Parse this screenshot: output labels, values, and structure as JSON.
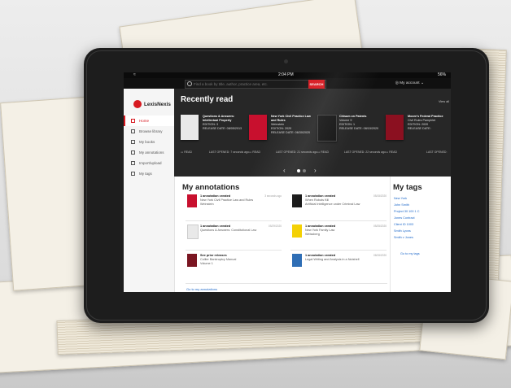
{
  "statusbar": {
    "time": "2:04 PM",
    "battery": "56%"
  },
  "search": {
    "placeholder": "Find a book by title, author, practice area, etc.",
    "button": "SEARCH"
  },
  "account": {
    "label": "My account"
  },
  "brand": {
    "name": "LexisNexis",
    "color": "#d71920"
  },
  "sidebar": {
    "items": [
      {
        "label": "Home",
        "icon": "home-icon",
        "active": true
      },
      {
        "label": "Browse library",
        "icon": "browse-icon"
      },
      {
        "label": "My books",
        "icon": "book-icon"
      },
      {
        "label": "My annotations",
        "icon": "pencil-icon"
      },
      {
        "label": "Import/upload",
        "icon": "upload-icon"
      },
      {
        "label": "My tags",
        "icon": "tag-icon"
      }
    ]
  },
  "recent": {
    "title": "Recently read",
    "view_all": "View all",
    "books": [
      {
        "title": "Questions & Answers: Intellectual Property",
        "edition_label": "EDITION:",
        "edition": "3",
        "release_label": "RELEASE DATE:",
        "release": "08/05/2013",
        "read": "READ",
        "last_opened": "LAST OPENED: 7 seconds ago",
        "cover": "#e9e9e9"
      },
      {
        "title": "New York Civil Practice Law and Rules",
        "extra": "Weinstein",
        "edition_label": "EDITION:",
        "edition": "2020",
        "release_label": "RELEASE DATE:",
        "release": "06/30/2020",
        "read": "READ",
        "last_opened": "LAST OPENED: 21 seconds ago",
        "cover": "#c8102e"
      },
      {
        "title": "Chisum on Patents",
        "extra": "Volume 9",
        "edition_label": "EDITION:",
        "edition": "1",
        "release_label": "RELEASE DATE:",
        "release": "08/15/2020",
        "read": "READ",
        "last_opened": "LAST OPENED: 22 seconds ago",
        "cover": "#161616"
      },
      {
        "title": "Moore's Federal Practice",
        "extra": "Civil Rules Pamphlet",
        "edition_label": "EDITION:",
        "edition": "2020",
        "release_label": "RELEASE DATE:",
        "release": "",
        "read": "READ",
        "last_opened": "LAST OPENED:",
        "cover": "#8b1020"
      }
    ]
  },
  "annotations": {
    "title": "My annotations",
    "go_to": "Go to my annotations",
    "items": [
      {
        "heading": "1 annotation created",
        "book": "New York Civil Practice Law and Rules",
        "sub": "Weinstein",
        "time": "3 seconds ago",
        "cover": "#c8102e"
      },
      {
        "heading": "1 annotation created",
        "book": "When Robots Kill",
        "sub": "Artificial Intelligence under Criminal Law",
        "time": "05/15/2020",
        "cover": "#111111"
      },
      {
        "heading": "1 annotation created",
        "book": "Questions & Answers: Constitutional Law",
        "sub": "",
        "time": "05/29/2020",
        "cover": "#e9e9e9"
      },
      {
        "heading": "1 annotation created",
        "book": "New York Family Law",
        "sub": "Weissberg",
        "time": "05/25/2020",
        "cover": "#f4d000"
      },
      {
        "heading": "See prior releases",
        "book": "Collier Bankruptcy Manual",
        "sub": "Volume 1",
        "time": "",
        "cover": "#7a1521"
      },
      {
        "heading": "1 annotation created",
        "book": "Legal Writing and Analysis in a Nutshell",
        "sub": "",
        "time": "08/15/2020",
        "cover": "#2f6eb5"
      }
    ]
  },
  "tags": {
    "title": "My tags",
    "items": [
      "New York",
      "John Smith",
      "Project 30 100 1 C",
      "Jones Contract",
      "Client ID 1003",
      "Smith Lyons",
      "Smith v Jones"
    ],
    "go_to": "Go to my tags"
  }
}
